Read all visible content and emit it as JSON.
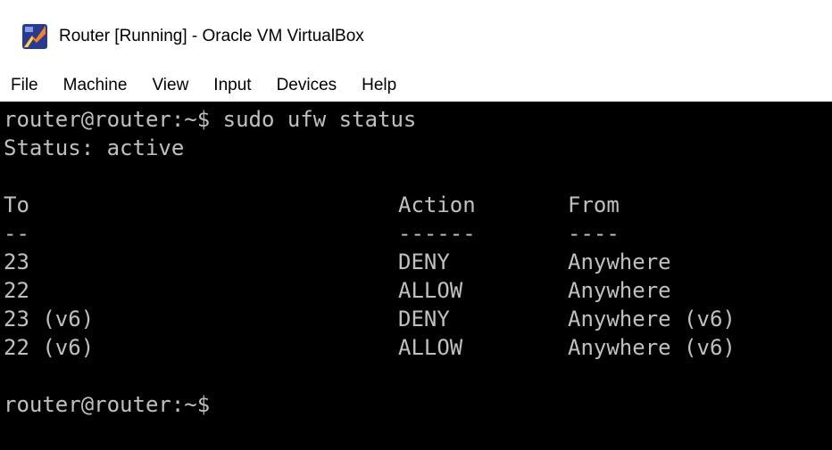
{
  "window": {
    "title": "Router [Running] - Oracle VM VirtualBox",
    "icon": "virtualbox-icon"
  },
  "menu": [
    "File",
    "Machine",
    "View",
    "Input",
    "Devices",
    "Help"
  ],
  "terminal": {
    "command_line": "router@router:~$ sudo ufw status",
    "status_line": "Status: active",
    "headers": {
      "to": "To",
      "action": "Action",
      "from": "From"
    },
    "separators": {
      "to": "--",
      "action": "------",
      "from": "----"
    },
    "rules": [
      {
        "to": "23",
        "action": "DENY",
        "from": "Anywhere"
      },
      {
        "to": "22",
        "action": "ALLOW",
        "from": "Anywhere"
      },
      {
        "to": "23 (v6)",
        "action": "DENY",
        "from": "Anywhere (v6)"
      },
      {
        "to": "22 (v6)",
        "action": "ALLOW",
        "from": "Anywhere (v6)"
      }
    ],
    "prompt": "router@router:~$"
  },
  "colors": {
    "terminal_bg": "#000000",
    "terminal_fg": "#c0c0c0"
  }
}
